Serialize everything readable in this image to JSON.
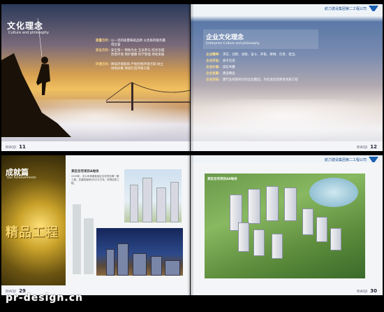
{
  "spread1": {
    "left": {
      "section_title": "文化理念",
      "section_subtitle": "Culture and philosophy",
      "items": [
        {
          "key": "质量方针:",
          "value": "以一流的质量铸就品牌 以优质的服务赢得信誉"
        },
        {
          "key": "安全方针:",
          "value": "安全第一 预防为主 全员参与 综合治理 改善环境 保护健康 科学管理 持续发展"
        },
        {
          "key": "环境方针:",
          "value": "降低环境影响 严格控制环境污染 树立绿色形象 持续打造环保工程"
        }
      ],
      "footer_label": "BIAOJI",
      "page_number": "11"
    },
    "right": {
      "company_logo_text": "航力建设集团第二工程公司",
      "panel_title": "企业文化理念",
      "panel_subtitle": "Enterprise Culture and philosophy",
      "items": [
        {
          "key": "企业精神:",
          "value": "求实、创新、进取、奋斗、开拓、拼搏、负责、担当、"
        },
        {
          "key": "企业宗旨:",
          "value": "质于信诺"
        },
        {
          "key": "企业价值:",
          "value": "诚信共赢"
        },
        {
          "key": "企业发展:",
          "value": "建设精品"
        },
        {
          "key": "企业目标:",
          "value": "建行业有影响力的企业集团，为社会创造更多优质工程"
        }
      ],
      "footer_label": "BIAOJI",
      "page_number": "12"
    }
  },
  "spread2": {
    "left": {
      "section_title": "成就篇",
      "section_subtitle": "Our Achievements",
      "big_word": "精品工程",
      "project_title": "某区住宅项目A地块",
      "project_desc": "2009年，本公司承建某某区住宅项目第一期工程，总建筑面积约8万平方米，获得优质工程。",
      "footer_label": "BIAOJI",
      "page_number": "29"
    },
    "right": {
      "company_logo_text": "航力建设集团第二工程公司",
      "render_caption": "某区住宅项目A8地块",
      "footer_label": "BIAOJI",
      "page_number": "30"
    }
  },
  "watermark": "pr-design.cn"
}
